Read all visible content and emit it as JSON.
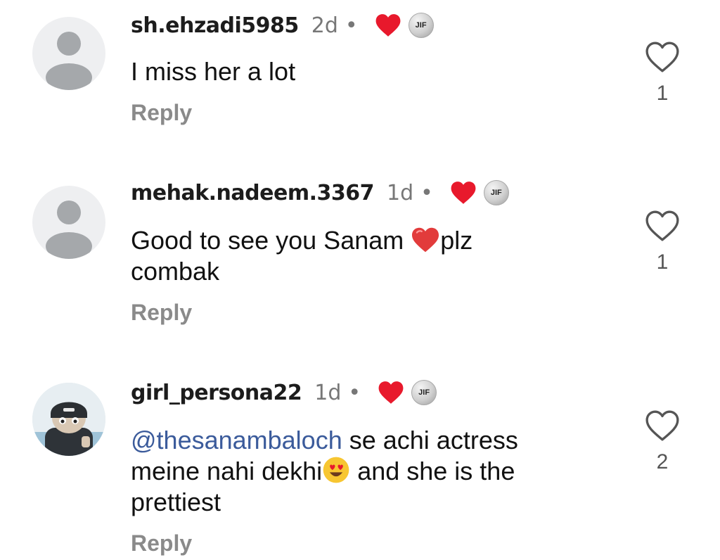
{
  "comments": [
    {
      "username": "sh.ehzadi5985",
      "time": "2d",
      "separator": "•",
      "badge": "JIF",
      "text": "I miss her a lot",
      "reply_label": "Reply",
      "likes": "1"
    },
    {
      "username": "mehak.nadeem.3367",
      "time": "1d",
      "separator": "•",
      "badge": "JIF",
      "text_before": "Good to see you Sanam ",
      "text_after": "plz",
      "text_line2": "combak",
      "reply_label": "Reply",
      "likes": "1"
    },
    {
      "username": "girl_persona22",
      "time": "1d",
      "separator": "•",
      "badge": "JIF",
      "mention": "@thesanambaloch",
      "text_line1_rest": " se achi actress",
      "text_line2_before": "meine nahi dekhi",
      "text_line2_after": " and she is the",
      "text_line3": "prettiest",
      "reply_label": "Reply",
      "likes": "2"
    }
  ],
  "colors": {
    "creator_heart": "#e8192c",
    "mention": "#3b5b9b",
    "reply": "#8a8a8a",
    "avatar_bg": "#eeeff1"
  },
  "icons": [
    "creator-liked-heart-icon",
    "heart-outline-icon",
    "red-heart-emoji",
    "heart-eyes-emoji"
  ]
}
